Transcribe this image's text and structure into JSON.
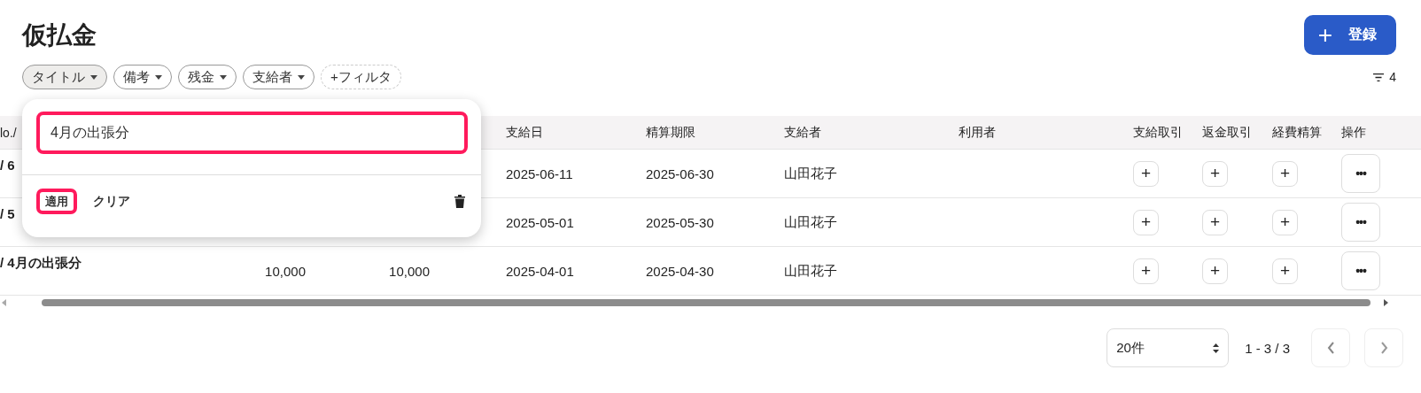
{
  "page_title": "仮払金",
  "register_button": {
    "icon": "+",
    "label": "登録"
  },
  "filter_chips": [
    {
      "kind": "field",
      "label": "タイトル",
      "selected": true
    },
    {
      "kind": "field",
      "label": "備考",
      "selected": false
    },
    {
      "kind": "field",
      "label": "残金",
      "selected": false
    },
    {
      "kind": "field",
      "label": "支給者",
      "selected": false
    },
    {
      "kind": "add",
      "label": "+フィルタ",
      "selected": false
    }
  ],
  "filter_count": "4",
  "table": {
    "columns": [
      {
        "kind": "text",
        "label": "lo./"
      },
      {
        "kind": "amount"
      },
      {
        "kind": "amount2"
      },
      {
        "kind": "text",
        "label": "支給日"
      },
      {
        "kind": "text",
        "label": "精算期限"
      },
      {
        "kind": "text",
        "label": "支給者"
      },
      {
        "kind": "text",
        "label": "利用者"
      },
      {
        "kind": "add",
        "label": "支給取引"
      },
      {
        "kind": "add",
        "label": "返金取引"
      },
      {
        "kind": "add",
        "label": "経費精算"
      },
      {
        "kind": "menu",
        "label": "操作"
      }
    ],
    "rows": [
      {
        "cells": [
          "/ 6",
          null,
          null,
          "2025-06-11",
          "2025-06-30",
          "山田花子",
          null,
          "+",
          "+",
          "+",
          "•••"
        ]
      },
      {
        "cells": [
          "/ 5",
          null,
          null,
          "2025-05-01",
          "2025-05-30",
          "山田花子",
          null,
          "+",
          "+",
          "+",
          "•••"
        ]
      },
      {
        "cells": [
          "/ 4月の出張分",
          "10,000",
          "10,000",
          "2025-04-01",
          "2025-04-30",
          "山田花子",
          null,
          "+",
          "+",
          "+",
          "•••"
        ]
      }
    ]
  },
  "title_filter_popup": {
    "value": "4月の出張分",
    "apply_label": "適用",
    "clear_label": "クリア"
  },
  "pagination": {
    "page_size": "20件",
    "range": "1 - 3 / 3"
  }
}
